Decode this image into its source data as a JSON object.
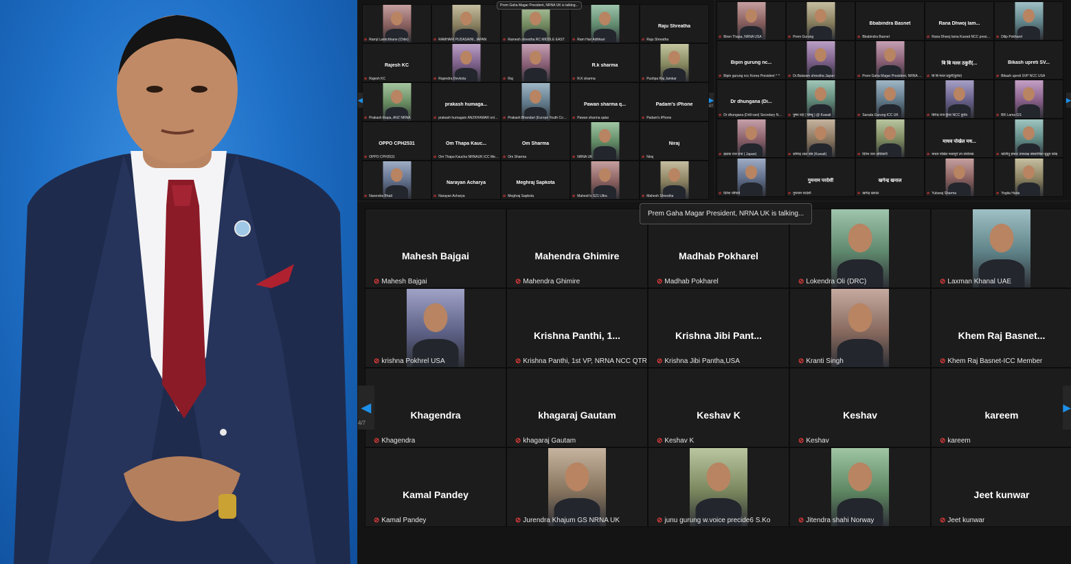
{
  "portrait": {
    "background": "#1e6fc6",
    "suit_color": "#1f2b4d",
    "tie_color": "#8c1b28"
  },
  "top_left_grid": {
    "speaking_tooltip": "Prem Gaha Magar President, NRNA UK is talking...",
    "tiles": [
      {
        "name": "",
        "label": "Ramji Lamichhane (Chile)",
        "video": true
      },
      {
        "name": "",
        "label": "RAMHARI PUDASAINI, JAPAN",
        "video": true
      },
      {
        "name": "",
        "label": "Ramesh shrestha RC MIDDLE EAST",
        "video": true
      },
      {
        "name": "",
        "label": "Ram Hari Adhikari",
        "video": true
      },
      {
        "name": "Raju Shreatha",
        "label": "Raju Shreatha",
        "video": false
      },
      {
        "name": "Rajesh KC",
        "label": "Rajesh KC",
        "video": false
      },
      {
        "name": "",
        "label": "Rajendra Devkota",
        "video": true
      },
      {
        "name": "",
        "label": "Raj",
        "video": true
      },
      {
        "name": "R.k sharma",
        "label": "R.K sharma",
        "video": false
      },
      {
        "name": "",
        "label": "Pushpa Raj Jamkar",
        "video": true
      },
      {
        "name": "",
        "label": "Prakash thapa, ANZ NRNA",
        "video": true
      },
      {
        "name": "prakash humaga...",
        "label": "prakash humagain ANZKHAMAR online Aut...",
        "video": false
      },
      {
        "name": "",
        "label": "Prakash Bhandari (Europe Youth Coordinat...",
        "video": true
      },
      {
        "name": "Pawan sharma q...",
        "label": "Pawan sharma qatar",
        "video": false
      },
      {
        "name": "Padam's iPhone",
        "label": "Padam's iPhone",
        "video": false
      },
      {
        "name": "OPPO CPH2531",
        "label": "OPPO CPH2531",
        "video": false
      },
      {
        "name": "Om Thapa Kauc...",
        "label": "Om Thapa Kaucha NRNAUK ICC Member",
        "video": false
      },
      {
        "name": "Om Sharma",
        "label": "Om Sharma",
        "video": false
      },
      {
        "name": "",
        "label": "NRNA UK",
        "video": true
      },
      {
        "name": "Niraj",
        "label": "Niraj",
        "video": false
      },
      {
        "name": "",
        "label": "Narendra Bhatt",
        "video": true
      },
      {
        "name": "Narayan Acharya",
        "label": "Narayan Acharya",
        "video": false
      },
      {
        "name": "Meghraj Sapkota",
        "label": "Meghraj Sapkota",
        "video": false
      },
      {
        "name": "",
        "label": "Mahesh's S21 Ultra",
        "video": true
      },
      {
        "name": "",
        "label": "Mahesh Shrestha",
        "video": true
      }
    ],
    "page": "3/7"
  },
  "top_right_grid": {
    "tiles": [
      {
        "name": "",
        "label": "Biren Thapa, NRNA USA",
        "video": true
      },
      {
        "name": "",
        "label": "Prem Gurung",
        "video": true
      },
      {
        "name": "Bbabindra Basnet",
        "label": "Bbabindra Basnet",
        "video": false
      },
      {
        "name": "Rana Dhwoj lam...",
        "label": "Rana Dhwoj lama Kuwait NCC president",
        "video": false
      },
      {
        "name": "",
        "label": "Dilip Pokharel",
        "video": true
      },
      {
        "name": "Bipin gurung nc...",
        "label": "Bipin gurung ncc Korea President ^ ^",
        "video": false
      },
      {
        "name": "",
        "label": "Dr.Balaram shrestha Japan",
        "video": true
      },
      {
        "name": "",
        "label": "Prem Gaha Magar President, NRNA UK",
        "video": true
      },
      {
        "name": "बि बि मल्ल ठकुरी(...",
        "label": "बि बि मल्ल ठकुरी(कुवेत)",
        "video": false
      },
      {
        "name": "Bikash upreti SV...",
        "label": "Bikash upreti SVP NCC USA",
        "video": false
      },
      {
        "name": "Dr dhungana (Di...",
        "label": "Dr dhungana (Drill-rani) Secretary NRNA US",
        "video": false
      },
      {
        "name": "",
        "label": "पुष्पा राई ( लिम्बू ) @ Kuwait",
        "video": true
      },
      {
        "name": "",
        "label": "Sarada Gurung ICC UK",
        "video": true
      },
      {
        "name": "",
        "label": "बिरेन्द्र राज कुँवर NCC कुवेत",
        "video": true
      },
      {
        "name": "",
        "label": "BR Lama GS",
        "video": true
      },
      {
        "name": "",
        "label": "झलक राज राना ( Japan)",
        "video": true
      },
      {
        "name": "",
        "label": "सोमेन्द्र लाल श्रेष्ठ (Kuwait)",
        "video": true
      },
      {
        "name": "",
        "label": "दिनेश राज अधिकारी",
        "video": true
      },
      {
        "name": "माधव पोखेल मध...",
        "label": "माधव पोखेल मध्यपूर्व उप संयोजक",
        "video": false
      },
      {
        "name": "",
        "label": "कल्पिनु हमाल उपाध्यक्ष संस्थापिका सुध्रुव कोस्",
        "video": true
      },
      {
        "name": "",
        "label": "दिनेश न्यौपाने",
        "video": true
      },
      {
        "name": "गुमनाम परदेशी",
        "label": "गुमनाम परदेशी",
        "video": false
      },
      {
        "name": "खगेन्द्र खनाल",
        "label": "खगेन्द्र खनाल",
        "video": false
      },
      {
        "name": "",
        "label": "Yubaraj Sharma",
        "video": true
      },
      {
        "name": "",
        "label": "Yogita Hada",
        "video": true
      }
    ]
  },
  "main_grid": {
    "speaking_tooltip": "Prem Gaha Magar President, NRNA UK is talking...",
    "page": "4/7",
    "tiles": [
      {
        "name": "Mahesh Bajgai",
        "label": "Mahesh Bajgai",
        "video": false
      },
      {
        "name": "Mahendra Ghimire",
        "label": "Mahendra Ghimire",
        "video": false
      },
      {
        "name": "Madhab Pokharel",
        "label": "Madhab Pokharel",
        "video": false
      },
      {
        "name": "",
        "label": "Lokendra Oli (DRC)",
        "video": true
      },
      {
        "name": "",
        "label": "Laxman Khanal UAE",
        "video": true
      },
      {
        "name": "",
        "label": "krishna Pokhrel USA",
        "video": true
      },
      {
        "name": "Krishna Panthi, 1...",
        "label": "Krishna Panthi, 1st VP, NRNA NCC QTR",
        "video": false
      },
      {
        "name": "Krishna Jibi Pant...",
        "label": "Krishna Jibi Pantha,USA",
        "video": false
      },
      {
        "name": "",
        "label": "Kranti Singh",
        "video": true
      },
      {
        "name": "Khem Raj Basnet...",
        "label": "Khem Raj Basnet-ICC Member",
        "video": false
      },
      {
        "name": "Khagendra",
        "label": "Khagendra",
        "video": false
      },
      {
        "name": "khagaraj Gautam",
        "label": "khagaraj Gautam",
        "video": false
      },
      {
        "name": "Keshav K",
        "label": "Keshav K",
        "video": false
      },
      {
        "name": "Keshav",
        "label": "Keshav",
        "video": false
      },
      {
        "name": "kareem",
        "label": "kareem",
        "video": false
      },
      {
        "name": "Kamal Pandey",
        "label": "Kamal Pandey",
        "video": false
      },
      {
        "name": "",
        "label": "Jurendra Khajum GS NRNA UK",
        "video": true
      },
      {
        "name": "",
        "label": "junu gurung w.voice precide6 S.Ko",
        "video": true
      },
      {
        "name": "",
        "label": "Jitendra shahi Norway",
        "video": true
      },
      {
        "name": "Jeet kunwar",
        "label": "Jeet kunwar",
        "video": false
      }
    ]
  }
}
